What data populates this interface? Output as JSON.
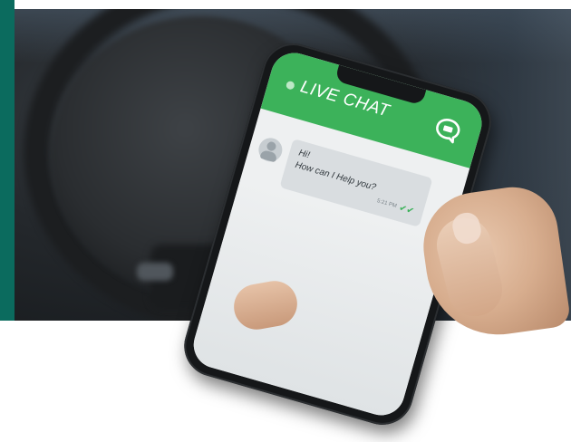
{
  "chat": {
    "header_title": "LIVE CHAT",
    "message_line1": "Hi!",
    "message_line2": "How can I Help you?",
    "message_time": "5:21 PM"
  },
  "colors": {
    "side_bar": "#0b6b5e",
    "chat_header": "#3cb25a"
  },
  "icons": [
    "chat-bubble-icon",
    "avatar-icon",
    "double-check-icon",
    "online-dot-icon"
  ]
}
